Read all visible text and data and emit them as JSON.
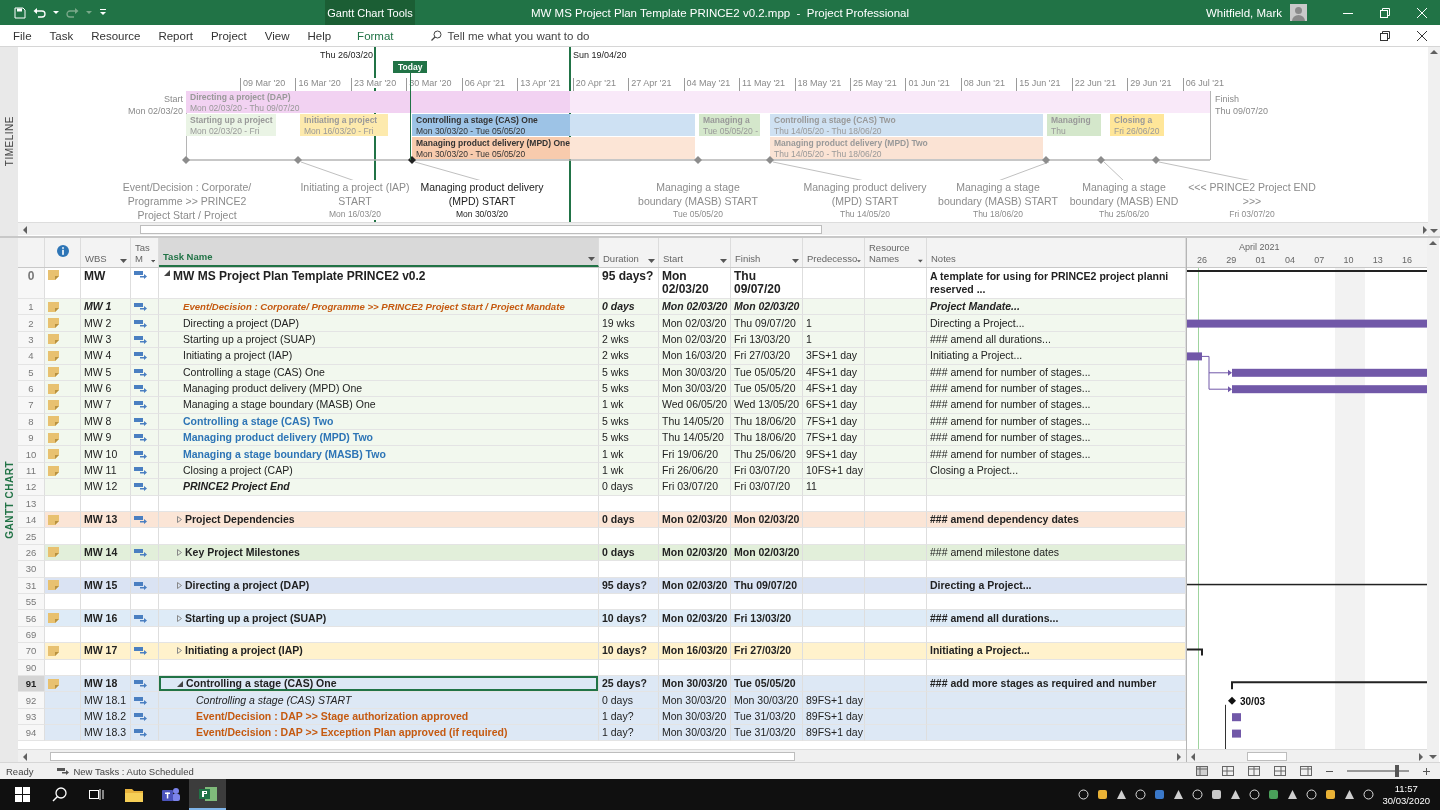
{
  "title_bar": {
    "context_tab": "Gantt Chart Tools",
    "title": "MW MS Project Plan Template PRINCE2 v0.2.mpp  -  Project Professional",
    "user": "Whitfield, Mark"
  },
  "ribbon": {
    "tabs": [
      {
        "label": "File",
        "kind": "standard"
      },
      {
        "label": "Task",
        "kind": "standard"
      },
      {
        "label": "Resource",
        "kind": "standard"
      },
      {
        "label": "Report",
        "kind": "standard"
      },
      {
        "label": "Project",
        "kind": "standard"
      },
      {
        "label": "View",
        "kind": "standard"
      },
      {
        "label": "Help",
        "kind": "standard"
      },
      {
        "label": "Format",
        "kind": "contextual"
      }
    ],
    "search": {
      "placeholder": "Tell me what you want to do"
    }
  },
  "timeline": {
    "label": "TIMELINE",
    "range_start": "Thu 26/03/20",
    "range_end": "Sun 19/04/20",
    "today": "Today",
    "ticks": [
      "09 Mar '20",
      "16 Mar '20",
      "23 Mar '20",
      "30 Mar '20",
      "06 Apr '21",
      "13 Apr '21",
      "20 Apr '21",
      "27 Apr '21",
      "04 May '21",
      "11 May '21",
      "18 May '21",
      "25 May '21",
      "01 Jun '21",
      "08 Jun '21",
      "15 Jun '21",
      "22 Jun '21",
      "29 Jun '21",
      "06 Jul '21"
    ],
    "start": {
      "label": "Start",
      "date": "Mon 02/03/20"
    },
    "finish": {
      "label": "Finish",
      "date": "Thu 09/07/20"
    },
    "bars": [
      {
        "title": "Directing a project (DAP)",
        "dates": "Mon 02/03/20 - Thu 09/07/20",
        "color": "#f2d2f2",
        "in_focus": false
      },
      {
        "title": "Starting up a project",
        "dates": "Mon 02/03/20 - Fri",
        "color": "#eaf4e5",
        "in_focus": false
      },
      {
        "title": "Initiating a project",
        "dates": "Mon 16/03/20 - Fri",
        "color": "#fdeaad",
        "in_focus": false
      },
      {
        "title": "Controlling a stage (CAS) One",
        "dates": "Mon 30/03/20 - Tue 05/05/20",
        "color": "#9dc3e6",
        "in_focus": true
      },
      {
        "title": "Managing a",
        "dates": "Tue 05/05/20 -",
        "color": "#d4e7cb",
        "in_focus": false
      },
      {
        "title": "Controlling a stage (CAS) Two",
        "dates": "Thu 14/05/20 - Thu 18/06/20",
        "color": "#cfe1f2",
        "in_focus": false
      },
      {
        "title": "Managing",
        "dates": "Thu",
        "color": "#d4e7cb",
        "in_focus": false
      },
      {
        "title": "Closing a",
        "dates": "Fri 26/06/20",
        "color": "#ffe699",
        "in_focus": false
      },
      {
        "title": "Managing product delivery (MPD) One",
        "dates": "Mon 30/03/20 - Tue 05/05/20",
        "color": "#f8cbad",
        "in_focus": true
      },
      {
        "title": "Managing product delivery (MPD) Two",
        "dates": "Thu 14/05/20 - Thu 18/06/20",
        "color": "#fbe3d4",
        "in_focus": false
      }
    ],
    "callouts": [
      {
        "text": "Event/Decision : Corporate/ Programme >> PRINCE2 Project Start / Project",
        "in_focus": false
      },
      {
        "text": "Initiating a project (IAP) START",
        "date": "Mon 16/03/20",
        "in_focus": false
      },
      {
        "text": "Managing product delivery (MPD) START",
        "date": "Mon 30/03/20",
        "in_focus": true
      },
      {
        "text": "Managing a stage boundary (MASB) START",
        "date": "Tue 05/05/20",
        "in_focus": false
      },
      {
        "text": "Managing product delivery (MPD) START",
        "date": "Thu 14/05/20",
        "in_focus": false
      },
      {
        "text": "Managing a stage boundary (MASB) START",
        "date": "Thu 18/06/20",
        "in_focus": false
      },
      {
        "text": "Managing a stage boundary (MASB) END",
        "date": "Thu 25/06/20",
        "in_focus": false
      },
      {
        "text": "<<< PRINCE2 Project END >>>",
        "date": "Fri 03/07/20",
        "in_focus": false
      }
    ]
  },
  "gantt": {
    "label": "GANTT CHART",
    "table": {
      "columns": [
        {
          "kind": "info",
          "selected": false
        },
        {
          "kind": "text",
          "label": "WBS",
          "menu": true,
          "selected": false
        },
        {
          "kind": "text",
          "label": "Tas M",
          "menu": true,
          "selected": false
        },
        {
          "kind": "text",
          "label": "Task Name",
          "menu": true,
          "selected": true
        },
        {
          "kind": "text",
          "label": "Duration",
          "menu": true,
          "selected": false
        },
        {
          "kind": "text",
          "label": "Start",
          "menu": true,
          "selected": false
        },
        {
          "kind": "text",
          "label": "Finish",
          "menu": true,
          "selected": false
        },
        {
          "kind": "text",
          "label": "Predecesso",
          "menu": true,
          "selected": false
        },
        {
          "kind": "text",
          "label": "Resource Names",
          "menu": true,
          "selected": false
        },
        {
          "kind": "text",
          "label": "Notes",
          "menu": false,
          "selected": false
        }
      ],
      "rows": [
        {
          "id": "0",
          "note": true,
          "wbs": "MW",
          "name": "MW MS Project Plan Template PRINCE2 v0.2",
          "duration": "95 days?",
          "start": "Mon 02/03/20",
          "finish": "Thu 09/07/20",
          "notes": "A template for using for PRINCE2 project planni\nreserved ...",
          "kind": "project",
          "expanded": true,
          "selected": false,
          "children": [
            {
              "id": "1",
              "note": true,
              "wbs": "MW 1",
              "name": "Event/Decision : Corporate/ Programme >> PRINCE2 Project Start / Project Mandate",
              "duration": "0 days",
              "start": "Mon 02/03/20",
              "finish": "Mon 02/03/20",
              "notes": "Project Mandate...",
              "kind": "mandate",
              "color": "#f2f8ee",
              "selected": false
            },
            {
              "id": "2",
              "note": true,
              "wbs": "MW 2",
              "name": "Directing a project (DAP)",
              "duration": "19 wks",
              "start": "Mon 02/03/20",
              "finish": "Thu 09/07/20",
              "predecessors": "1",
              "notes": "Directing a Project...",
              "kind": "task",
              "color": "#f2f8ee",
              "selected": false
            },
            {
              "id": "3",
              "note": true,
              "wbs": "MW 3",
              "name": "Starting up a project (SUAP)",
              "duration": "2 wks",
              "start": "Mon 02/03/20",
              "finish": "Fri 13/03/20",
              "predecessors": "1",
              "notes": "### amend all durations...",
              "kind": "task",
              "color": "#f2f8ee",
              "selected": false
            },
            {
              "id": "4",
              "note": true,
              "wbs": "MW 4",
              "name": "Initiating a project (IAP)",
              "duration": "2 wks",
              "start": "Mon 16/03/20",
              "finish": "Fri 27/03/20",
              "predecessors": "3FS+1 day",
              "notes": "Initiating a Project...",
              "kind": "task",
              "color": "#f2f8ee",
              "selected": false
            },
            {
              "id": "5",
              "note": true,
              "wbs": "MW 5",
              "name": "Controlling a stage (CAS) One",
              "duration": "5 wks",
              "start": "Mon 30/03/20",
              "finish": "Tue 05/05/20",
              "predecessors": "4FS+1 day",
              "notes": "### amend for number of stages...",
              "kind": "task",
              "color": "#f2f8ee",
              "selected": false
            },
            {
              "id": "6",
              "note": true,
              "wbs": "MW 6",
              "name": "Managing product delivery (MPD) One",
              "duration": "5 wks",
              "start": "Mon 30/03/20",
              "finish": "Tue 05/05/20",
              "predecessors": "4FS+1 day",
              "notes": "### amend for number of stages...",
              "kind": "task",
              "color": "#f2f8ee",
              "selected": false
            },
            {
              "id": "7",
              "note": true,
              "wbs": "MW 7",
              "name": "Managing a stage boundary (MASB) One",
              "duration": "1 wk",
              "start": "Wed 06/05/20",
              "finish": "Wed 13/05/20",
              "predecessors": "6FS+1 day",
              "notes": "### amend for number of stages...",
              "kind": "task",
              "color": "#f2f8ee",
              "selected": false
            },
            {
              "id": "8",
              "note": true,
              "wbs": "MW 8",
              "name": "Controlling a stage (CAS) Two",
              "duration": "5 wks",
              "start": "Thu 14/05/20",
              "finish": "Thu 18/06/20",
              "predecessors": "7FS+1 day",
              "notes": "### amend for number of stages...",
              "kind": "stage",
              "color": "#f2f8ee",
              "selected": false
            },
            {
              "id": "9",
              "note": true,
              "wbs": "MW 9",
              "name": "Managing product delivery (MPD) Two",
              "duration": "5 wks",
              "start": "Thu 14/05/20",
              "finish": "Thu 18/06/20",
              "predecessors": "7FS+1 day",
              "notes": "### amend for number of stages...",
              "kind": "stage",
              "color": "#f2f8ee",
              "selected": false
            },
            {
              "id": "10",
              "note": true,
              "wbs": "MW 10",
              "name": "Managing a stage boundary (MASB) Two",
              "duration": "1 wk",
              "start": "Fri 19/06/20",
              "finish": "Thu 25/06/20",
              "predecessors": "9FS+1 day",
              "notes": "### amend for number of stages...",
              "kind": "stage",
              "color": "#f2f8ee",
              "selected": false
            },
            {
              "id": "11",
              "note": true,
              "wbs": "MW 11",
              "name": "Closing a project (CAP)",
              "duration": "1 wk",
              "start": "Fri 26/06/20",
              "finish": "Fri 03/07/20",
              "predecessors": "10FS+1 day",
              "notes": "Closing a Project...",
              "kind": "task",
              "color": "#f2f8ee",
              "selected": false
            },
            {
              "id": "12",
              "note": false,
              "wbs": "MW 12",
              "name": "PRINCE2 Project End",
              "duration": "0 days",
              "start": "Fri 03/07/20",
              "finish": "Fri 03/07/20",
              "predecessors": "11",
              "kind": "end",
              "color": "#f2f8ee",
              "selected": false
            },
            {
              "id": "13",
              "kind": "blank",
              "selected": false
            },
            {
              "id": "14",
              "note": true,
              "wbs": "MW 13",
              "name": "Project Dependencies",
              "duration": "0 days",
              "start": "Mon 02/03/20",
              "finish": "Mon 02/03/20",
              "notes": "### amend dependency dates",
              "notes_bold": true,
              "kind": "group",
              "color": "#fbe5d6",
              "expanded": false,
              "selected": false
            },
            {
              "id": "25",
              "kind": "blank",
              "selected": false
            },
            {
              "id": "26",
              "note": true,
              "wbs": "MW 14",
              "name": "Key Project Milestones",
              "duration": "0 days",
              "start": "Mon 02/03/20",
              "finish": "Mon 02/03/20",
              "notes": "### amend milestone dates",
              "notes_bold": false,
              "kind": "group",
              "color": "#e2efda",
              "expanded": false,
              "selected": false
            },
            {
              "id": "30",
              "kind": "blank",
              "selected": false
            },
            {
              "id": "31",
              "note": true,
              "wbs": "MW 15",
              "name": "Directing a project (DAP)",
              "duration": "95 days?",
              "start": "Mon 02/03/20",
              "finish": "Thu 09/07/20",
              "notes": "Directing a Project...",
              "notes_bold": true,
              "kind": "group",
              "color": "#dae3f3",
              "expanded": false,
              "selected": false
            },
            {
              "id": "55",
              "kind": "blank",
              "selected": false
            },
            {
              "id": "56",
              "note": true,
              "wbs": "MW 16",
              "name": "Starting up a project (SUAP)",
              "duration": "10 days?",
              "start": "Mon 02/03/20",
              "finish": "Fri 13/03/20",
              "notes": "### amend all durations...",
              "notes_bold": true,
              "kind": "group",
              "color": "#deebf7",
              "expanded": false,
              "selected": false
            },
            {
              "id": "69",
              "kind": "blank",
              "selected": false
            },
            {
              "id": "70",
              "note": true,
              "wbs": "MW 17",
              "name": "Initiating a project (IAP)",
              "duration": "10 days?",
              "start": "Mon 16/03/20",
              "finish": "Fri 27/03/20",
              "notes": "Initiating a Project...",
              "notes_bold": true,
              "kind": "group",
              "color": "#fff2cc",
              "expanded": false,
              "selected": false
            },
            {
              "id": "90",
              "kind": "blank",
              "selected": false
            },
            {
              "id": "91",
              "note": true,
              "wbs": "MW 18",
              "name": "Controlling a stage (CAS) One",
              "duration": "25 days?",
              "start": "Mon 30/03/20",
              "finish": "Tue 05/05/20",
              "notes": "### add more stages as required and number",
              "notes_bold": true,
              "kind": "group",
              "color": "#dde8f5",
              "expanded": true,
              "selected": true,
              "children": [
                {
                  "id": "92",
                  "note": false,
                  "wbs": "MW 18.1",
                  "name": "Controlling a stage (CAS) START",
                  "duration": "0 days",
                  "start": "Mon 30/03/20",
                  "finish": "Mon 30/03/20",
                  "predecessors": "89FS+1 day",
                  "kind": "subtask",
                  "color": "#dde8f5",
                  "selected": false
                },
                {
                  "id": "93",
                  "note": false,
                  "wbs": "MW 18.2",
                  "name": "Event/Decision : DAP >> Stage authorization approved",
                  "duration": "1 day?",
                  "start": "Mon 30/03/20",
                  "finish": "Tue 31/03/20",
                  "predecessors": "89FS+1 day",
                  "kind": "event",
                  "color": "#dde8f5",
                  "selected": false
                },
                {
                  "id": "94",
                  "note": false,
                  "wbs": "MW 18.3",
                  "name": "Event/Decision : DAP >> Exception Plan approved (if required)",
                  "duration": "1 day?",
                  "start": "Mon 30/03/20",
                  "finish": "Tue 31/03/20",
                  "predecessors": "89FS+1 day",
                  "kind": "event",
                  "color": "#dde8f5",
                  "selected": false
                }
              ]
            }
          ]
        }
      ]
    },
    "chart": {
      "month": "April 2021",
      "days": [
        "26",
        "29",
        "01",
        "04",
        "07",
        "10",
        "13",
        "16"
      ],
      "milestone_label": "30/03"
    }
  },
  "status_bar": {
    "ready": "Ready",
    "mode": "New Tasks : Auto Scheduled",
    "zoom": {
      "level": 0.8
    }
  },
  "taskbar": {
    "apps": [
      {
        "kind": "explorer",
        "selected": false
      },
      {
        "kind": "teams",
        "selected": false
      },
      {
        "kind": "project",
        "selected": true
      }
    ],
    "time": "11:57",
    "date": "30/03/2020"
  }
}
